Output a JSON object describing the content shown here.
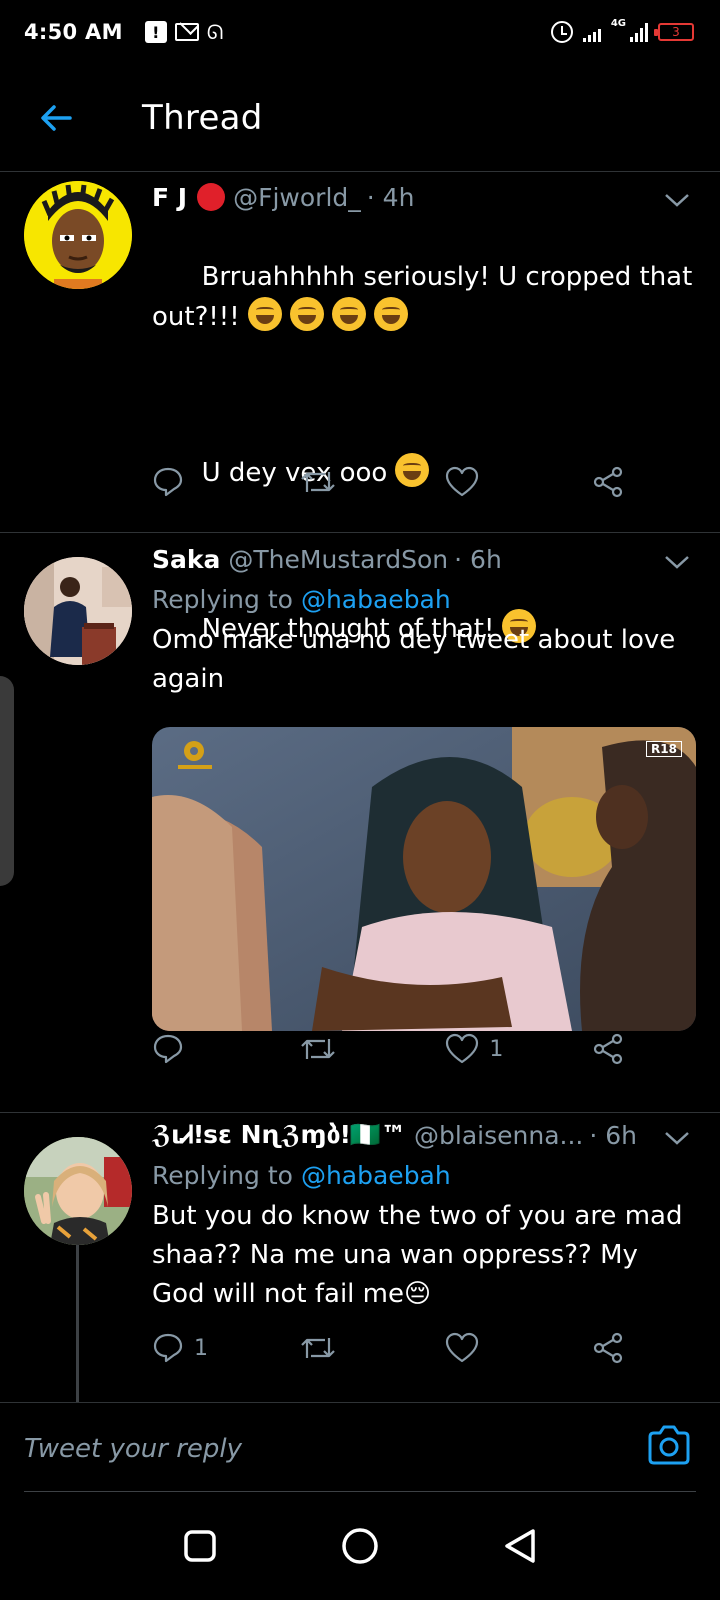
{
  "status_bar": {
    "time": "4:50 AM",
    "network": "4G",
    "battery": "3"
  },
  "header": {
    "title": "Thread"
  },
  "tweets": [
    {
      "name": "F J",
      "handle": "@Fjworld_",
      "time": "· 4h",
      "text_1": "Brruahhhhh seriously! U cropped that out?!!!",
      "text_2": "U dey vex ooo",
      "text_3": "Never thought of that!",
      "replies": "",
      "retweets": "",
      "likes": ""
    },
    {
      "name": "Saka",
      "handle": "@TheMustardSon",
      "time": "· 6h",
      "replying_label": "Replying to",
      "replying_to": "@habaebah",
      "text": "Omo make una no dey tweet about love again",
      "media_badge": "R18",
      "replies": "",
      "retweets": "",
      "likes": "1"
    },
    {
      "name": "ℨιᏗǃsɛ Nɳℨɱბǃ🇳🇬™",
      "handle": "@blaisenna...",
      "time": "· 6h",
      "replying_label": "Replying to",
      "replying_to": "@habaebah",
      "text": "But you do know the two of you are mad shaa?? Na me una wan oppress?? My God will not fail me😔",
      "replies": "1",
      "retweets": "",
      "likes": ""
    }
  ],
  "composer": {
    "placeholder": "Tweet your reply"
  },
  "colors": {
    "accent": "#1da1f2",
    "muted": "#8899a6",
    "divider": "#2f3336",
    "background": "#000000"
  }
}
